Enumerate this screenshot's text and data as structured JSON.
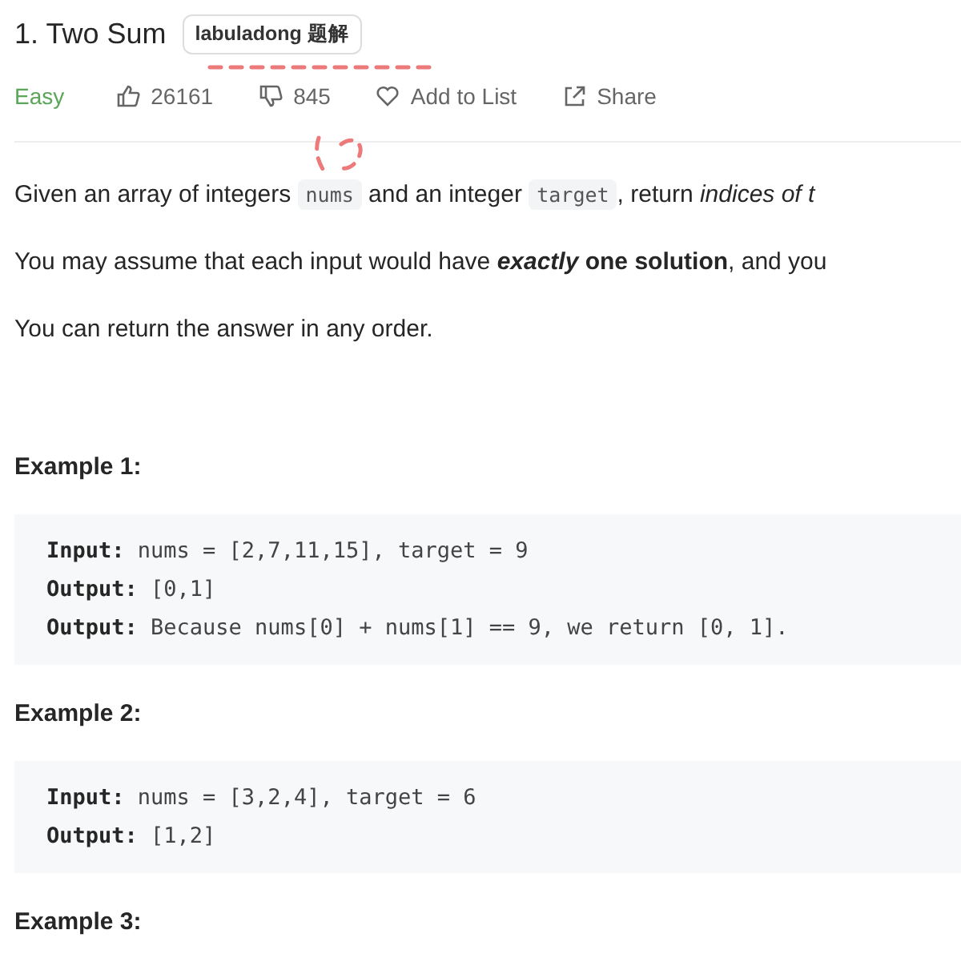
{
  "title": "1. Two Sum",
  "badge": "labuladong 题解",
  "meta": {
    "difficulty": "Easy",
    "likes": "26161",
    "dislikes": "845",
    "add_to_list": "Add to List",
    "share": "Share"
  },
  "paragraphs": [
    [
      {
        "kind": "text",
        "text": "Given an array of integers "
      },
      {
        "kind": "code",
        "text": "nums"
      },
      {
        "kind": "text",
        "text": " and an integer "
      },
      {
        "kind": "code",
        "text": "target"
      },
      {
        "kind": "text",
        "text": ", return *indices of t*"
      }
    ],
    [
      {
        "kind": "text",
        "text": "You may assume that each input would have "
      },
      {
        "kind": "emphasis",
        "text": "exactly"
      },
      {
        "kind": "text",
        "text": " **one solution**, and you"
      }
    ],
    [
      {
        "kind": "text",
        "text": "You can return the answer in any order."
      }
    ]
  ],
  "examples": [
    {
      "heading": "Example 1:",
      "lines": [
        {
          "label": "Input:",
          "text": "nums = [2,7,11,15], target = 9"
        },
        {
          "label": "Output:",
          "text": "[0,1]"
        },
        {
          "label": "Output:",
          "text": "Because nums[0] + nums[1] == 9, we return [0, 1]."
        }
      ]
    },
    {
      "heading": "Example 2:",
      "lines": [
        {
          "label": "Input:",
          "text": "nums = [3,2,4], target = 6"
        },
        {
          "label": "Output:",
          "text": "[1,2]"
        }
      ]
    },
    {
      "heading": "Example 3:"
    }
  ]
}
